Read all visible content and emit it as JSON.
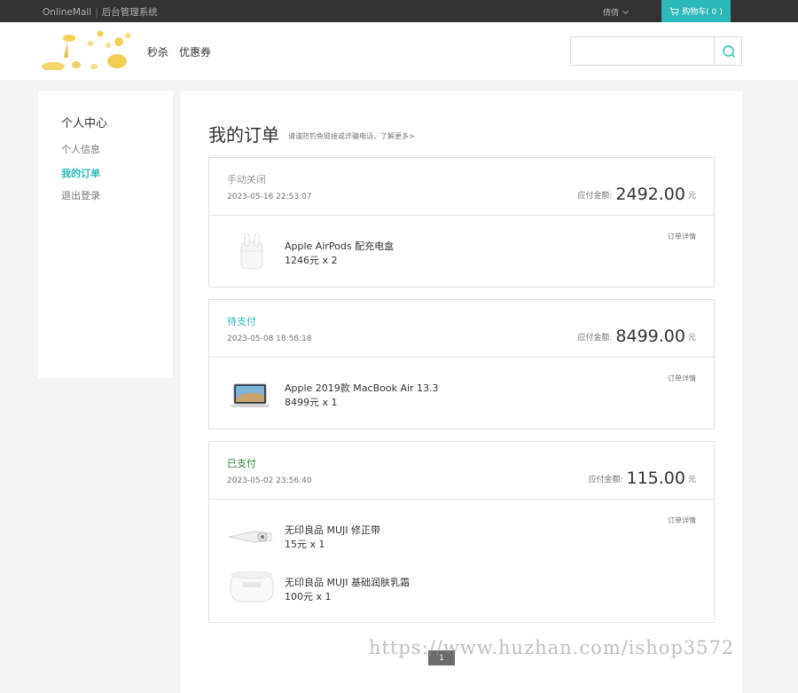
{
  "topbar": {
    "brand": "OnlineMall",
    "admin_link": "后台管理系统",
    "username": "倩倩",
    "cart_label": "购物车( 0 )"
  },
  "header": {
    "nav": [
      "秒杀",
      "优惠券"
    ],
    "search_placeholder": ""
  },
  "sidebar": {
    "title": "个人中心",
    "items": [
      {
        "label": "个人信息",
        "active": false
      },
      {
        "label": "我的订单",
        "active": true
      },
      {
        "label": "退出登录",
        "active": false
      }
    ]
  },
  "main": {
    "title": "我的订单",
    "tip": "请谨防钓鱼链接或诈骗电话，了解更多>",
    "amount_label": "应付金额:",
    "currency_unit": "元",
    "detail_label": "订单详情",
    "orders": [
      {
        "status": "手动关闭",
        "status_color": "#999999",
        "time": "2023-05-16 22:53:07",
        "amount": "2492.00",
        "products": [
          {
            "name": "Apple AirPods 配充电盒",
            "price": "1246元 x 2",
            "icon": "airpods-icon"
          }
        ]
      },
      {
        "status": "待支付",
        "status_color": "#2bb8b8",
        "time": "2023-05-08 18:58:18",
        "amount": "8499.00",
        "products": [
          {
            "name": "Apple 2019款 MacBook Air 13.3",
            "price": "8499元 x 1",
            "icon": "macbook-icon"
          }
        ]
      },
      {
        "status": "已支付",
        "status_color": "#2e7d32",
        "time": "2023-05-02 23:56:40",
        "amount": "115.00",
        "products": [
          {
            "name": "无印良品 MUJI 修正带",
            "price": "15元 x 1",
            "icon": "correction-tape-icon"
          },
          {
            "name": "无印良品 MUJI 基础润肤乳霜",
            "price": "100元 x 1",
            "icon": "cream-jar-icon"
          }
        ]
      }
    ]
  },
  "pager": {
    "current": "1"
  },
  "watermark": "https://www.huzhan.com/ishop3572",
  "colors": {
    "accent": "#2bb8b8",
    "topbar": "#333333"
  }
}
